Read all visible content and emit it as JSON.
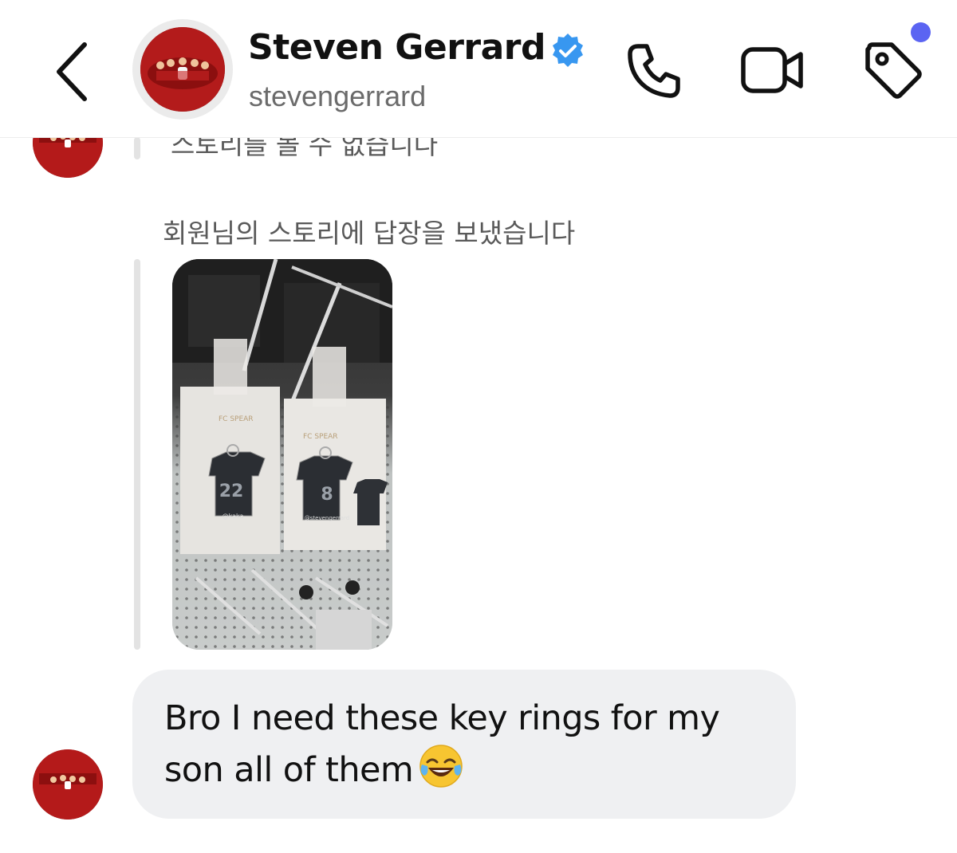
{
  "header": {
    "name": "Steven Gerrard",
    "handle": "stevengerrard",
    "verified": true,
    "icons": [
      "chevron-left-icon",
      "verified-badge-icon",
      "phone-icon",
      "video-camera-icon",
      "tag-icon"
    ],
    "notification_dot_color": "#5b64f2"
  },
  "thread": {
    "unavailable_story_text": "스토리를 볼 수 없습니다",
    "story_reply_label": "회원님의 스토리에 답장을 보냈습니다",
    "story_image": {
      "brand_text": "FC SPEAR",
      "keyring_left_number": "22",
      "keyring_left_handle": "@kaka",
      "keyring_right_number": "8",
      "keyring_right_handle": "@stevengerrard"
    },
    "message": {
      "text": "Bro I need these key rings for my son all of them",
      "emoji": "face-with-tears-of-joy"
    }
  },
  "colors": {
    "bubble_bg": "#eff0f2",
    "verified_blue": "#3897f0",
    "secondary_text": "#6b6b6b"
  }
}
